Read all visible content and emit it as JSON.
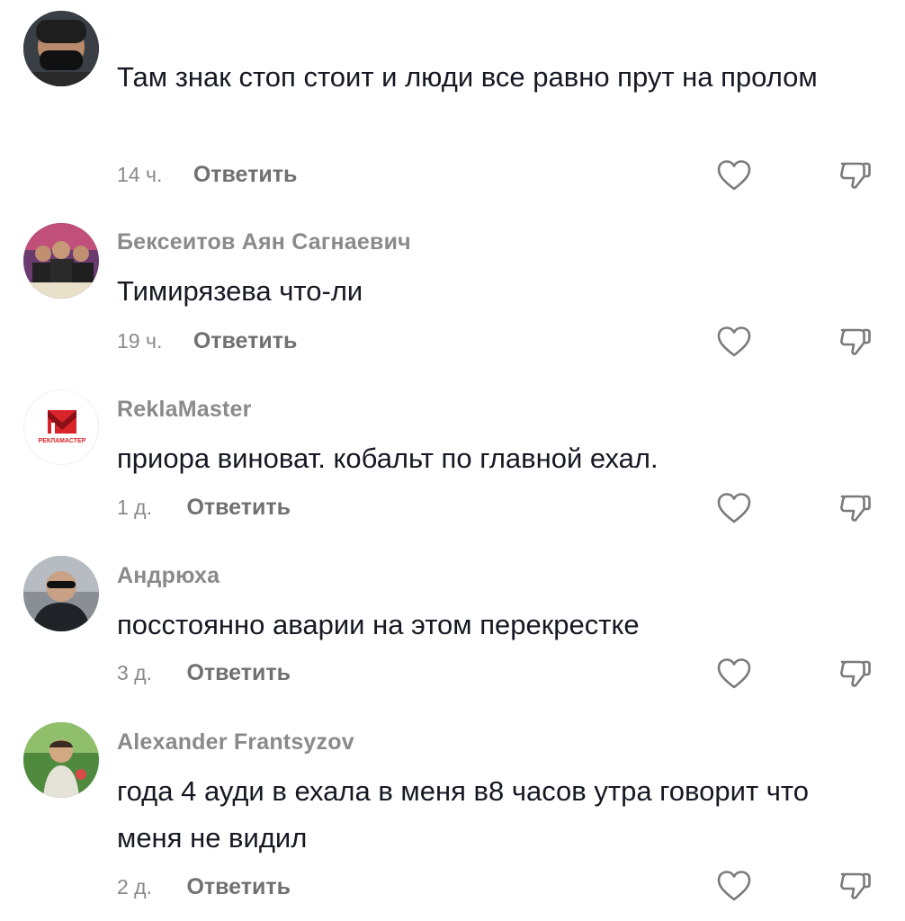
{
  "comments": [
    {
      "author": "",
      "text": "Там знак стоп стоит и люди все равно прут на пролом",
      "time": "14 ч.",
      "reply": "Ответить",
      "avatar": "avatar-person-mask"
    },
    {
      "author": "Бексеитов Аян Сагнаевич",
      "text": "Тимирязева что-ли",
      "time": "19 ч.",
      "reply": "Ответить",
      "avatar": "avatar-group-photo"
    },
    {
      "author": "ReklaMaster",
      "text": "приора виноват. кобальт по главной ехал.",
      "time": "1 д.",
      "reply": "Ответить",
      "avatar": "avatar-logo",
      "logo_caption": "РЕКЛАМАСТЕР"
    },
    {
      "author": "Андрюха",
      "text": "посстоянно аварии на этом перекрестке",
      "time": "3 д.",
      "reply": "Ответить",
      "avatar": "avatar-man-sunglasses"
    },
    {
      "author": "Alexander Frantsyzov",
      "text": "года 4 ауди в ехала в меня в8 часов утра говорит что меня не видил",
      "time": "2 д.",
      "reply": "Ответить",
      "avatar": "avatar-child-photo"
    }
  ],
  "icons": {
    "like": "heart-outline-icon",
    "dislike": "thumbs-down-outline-icon"
  },
  "colors": {
    "text": "#161823",
    "muted": "#8a8a8a",
    "reply": "#707070",
    "logo_red": "#d8232a"
  }
}
